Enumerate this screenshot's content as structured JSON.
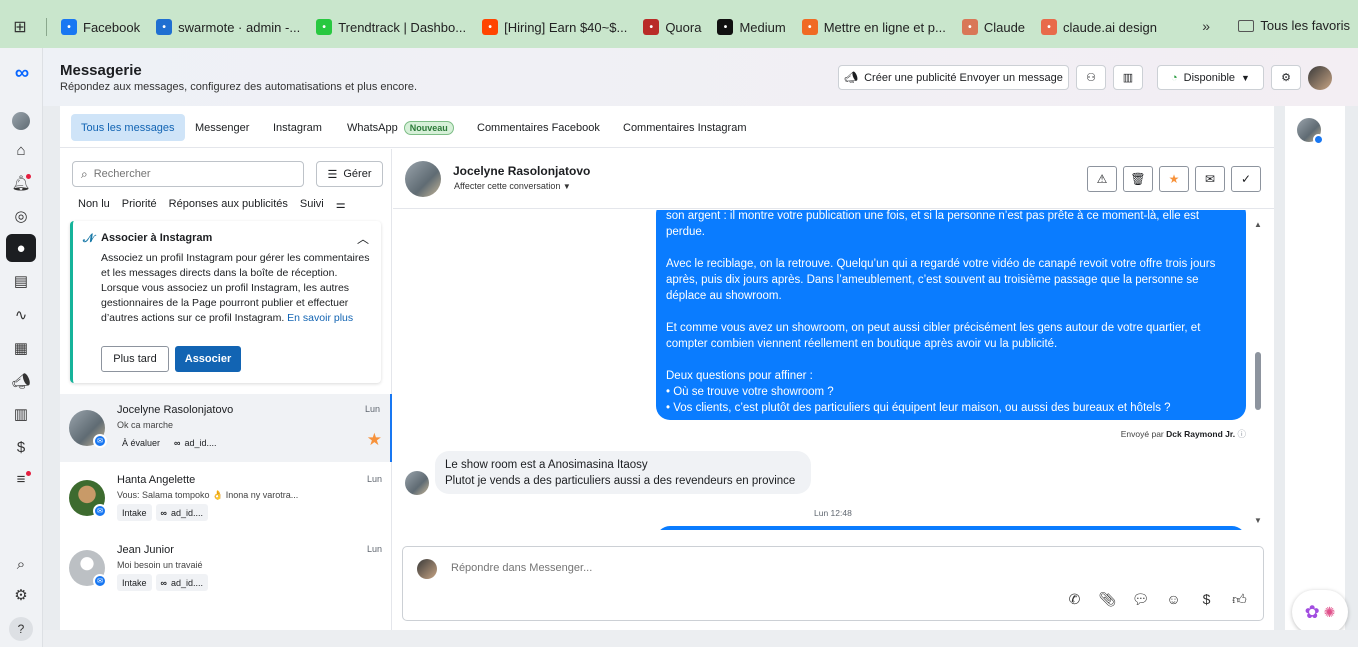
{
  "bookmarks": {
    "items": [
      {
        "label": "Facebook",
        "icon": "facebook-icon",
        "color": "#1877f2"
      },
      {
        "label": "swarmote · admin -...",
        "icon": "swarmote-icon",
        "color": "#1f6fd1"
      },
      {
        "label": "Trendtrack | Dashbo...",
        "icon": "trendtrack-icon",
        "color": "#28c840"
      },
      {
        "label": "[Hiring] Earn $40~$...",
        "icon": "reddit-icon",
        "color": "#ff4500"
      },
      {
        "label": "Quora",
        "icon": "quora-icon",
        "color": "#b92b27"
      },
      {
        "label": "Medium",
        "icon": "medium-icon",
        "color": "#111111"
      },
      {
        "label": "Mettre en ligne et p...",
        "icon": "upload-icon",
        "color": "#f06a23"
      },
      {
        "label": "Claude",
        "icon": "claude-icon",
        "color": "#d97757"
      },
      {
        "label": "claude.ai design",
        "icon": "palette-icon",
        "color": "#e86a4a"
      }
    ],
    "more": "»",
    "favorites": "Tous les favoris"
  },
  "header": {
    "title": "Messagerie",
    "subtitle": "Répondez aux messages, configurez des automatisations et plus encore.",
    "create_ad": "Créer une publicité Envoyer un message",
    "status": "Disponible"
  },
  "tabs": [
    {
      "label": "Tous les messages",
      "active": true
    },
    {
      "label": "Messenger"
    },
    {
      "label": "Instagram"
    },
    {
      "label": "WhatsApp",
      "badge": "Nouveau"
    },
    {
      "label": "Commentaires Facebook"
    },
    {
      "label": "Commentaires Instagram"
    }
  ],
  "inbox": {
    "search_placeholder": "Rechercher",
    "manage": "Gérer",
    "filters": [
      "Non lu",
      "Priorité",
      "Réponses aux publicités",
      "Suivi"
    ],
    "ig_card": {
      "title": "Associer à Instagram",
      "body": "Associez un profil Instagram pour gérer les commentaires et les messages directs dans la boîte de réception. Lorsque vous associez un profil Instagram, les autres gestionnaires de la Page pourront publier et effectuer d’autres actions sur ce profil Instagram.",
      "link": "En savoir plus",
      "later": "Plus tard",
      "associate": "Associer"
    },
    "conversations": [
      {
        "name": "Jocelyne Rasolonjatovo",
        "preview": "Ok ca marche",
        "time": "Lun",
        "tags": [
          "À évaluer",
          "ad_id...."
        ],
        "starred": true,
        "selected": true
      },
      {
        "name": "Hanta Angelette",
        "preview": "Vous: Salama tompoko 👌 Inona ny varotra...",
        "time": "Lun",
        "tags": [
          "Intake",
          "ad_id...."
        ]
      },
      {
        "name": "Jean Junior",
        "preview": "Moi besoin un travaié",
        "time": "Lun",
        "tags": [
          "Intake",
          "ad_id...."
        ]
      }
    ]
  },
  "chat": {
    "name": "Jocelyne Rasolonjatovo",
    "assign": "Affecter cette conversation",
    "outgoing": [
      "son argent : il montre votre publication une fois, et si la personne n’est pas prête à ce moment-là, elle est perdue.",
      "Avec le reciblage, on la retrouve. Quelqu’un qui a regardé votre vidéo de canapé revoit votre offre trois jours après, puis dix jours après. Dans l’ameublement, c’est souvent au troisième passage que la personne se déplace au showroom.",
      "Et comme vous avez un showroom, on peut aussi cibler précisément les gens autour de votre quartier, et compter combien viennent réellement en boutique après avoir vu la publicité.",
      "Deux questions pour affiner :",
      "• Où se trouve votre showroom ?",
      "• Vos clients, c’est plutôt des particuliers qui équipent leur maison, ou aussi des bureaux et hôtels ?"
    ],
    "sent_by_prefix": "Envoyé par",
    "sent_by_name": "Dck Raymond Jr.",
    "incoming": [
      "Le show room est a Anosimasina Itaosy",
      "Plutot je vends a des particuliers aussi a des revendeurs en province"
    ],
    "time": "Lun 12:48",
    "composer_placeholder": "Répondre dans Messenger..."
  }
}
